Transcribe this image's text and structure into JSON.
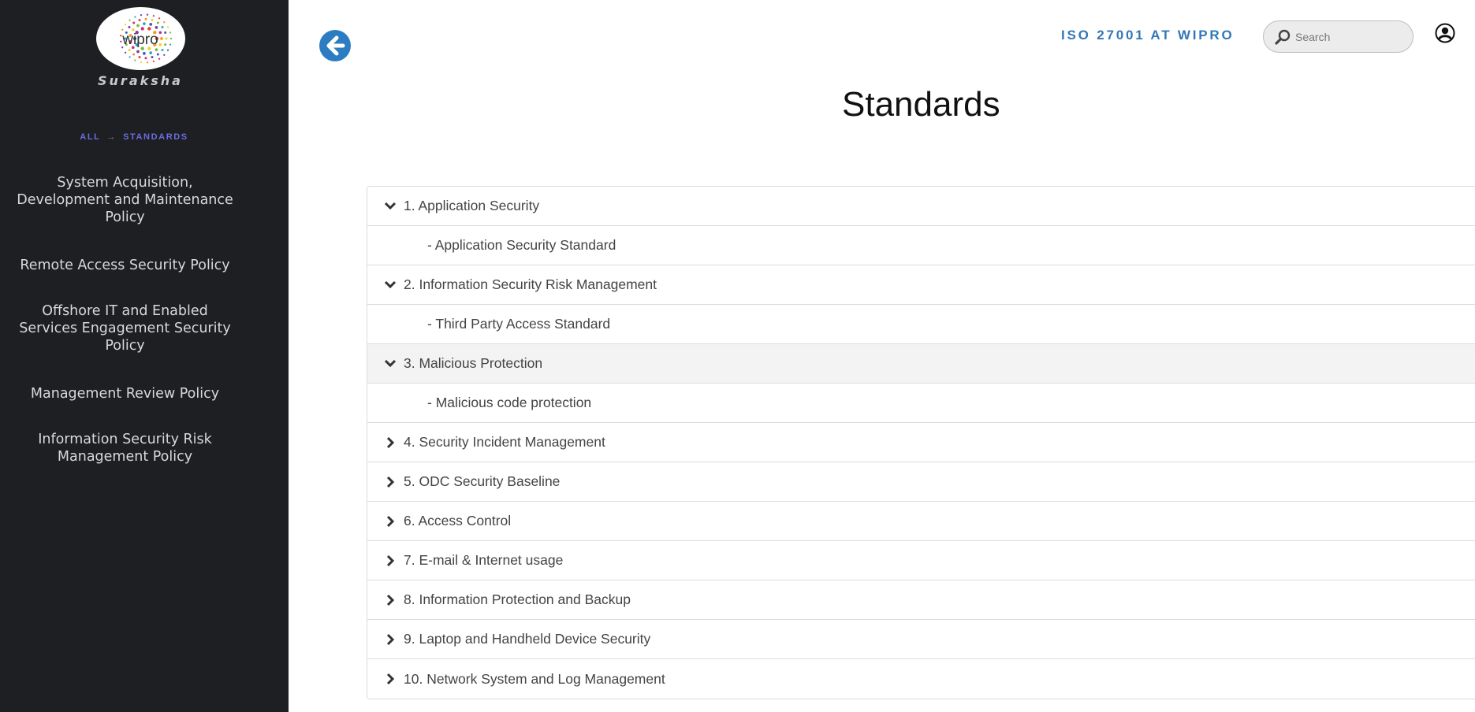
{
  "sidebar": {
    "brand": "Suraksha",
    "logo_text": "wipro",
    "breadcrumb": {
      "root": "ALL",
      "separator": "→",
      "current": "STANDARDS"
    },
    "nav_items": [
      {
        "label": "System Acquisition, Development and Maintenance Policy"
      },
      {
        "label": "Remote Access Security Policy"
      },
      {
        "label": "Offshore IT and Enabled Services Engagement Security Policy"
      },
      {
        "label": "Management Review Policy"
      },
      {
        "label": "Information Security Risk Management Policy"
      }
    ]
  },
  "header": {
    "title": "ISO 27001 AT WIPRO",
    "search_placeholder": "Search",
    "back_icon": "arrow-left-circle-icon",
    "user_icon": "user-circle-icon"
  },
  "page": {
    "title": "Standards"
  },
  "standards": [
    {
      "label": "1. Application Security",
      "expanded": true,
      "children": [
        "- Application Security Standard"
      ]
    },
    {
      "label": "2. Information Security Risk Management",
      "expanded": true,
      "children": [
        "- Third Party Access Standard"
      ]
    },
    {
      "label": "3. Malicious Protection",
      "expanded": true,
      "highlighted": true,
      "children": [
        "- Malicious code protection"
      ]
    },
    {
      "label": "4. Security Incident Management",
      "expanded": false
    },
    {
      "label": "5. ODC Security Baseline",
      "expanded": false
    },
    {
      "label": "6. Access Control",
      "expanded": false
    },
    {
      "label": "7. E-mail & Internet usage",
      "expanded": false
    },
    {
      "label": "8. Information Protection and Backup",
      "expanded": false
    },
    {
      "label": "9. Laptop and Handheld Device Security",
      "expanded": false
    },
    {
      "label": "10. Network System and Log Management",
      "expanded": false
    }
  ],
  "colors": {
    "sidebar_bg": "#1e1f23",
    "accent_blue": "#3377b8",
    "breadcrumb_purple": "#6a6ee0",
    "highlight_row": "#f3f3f3"
  }
}
